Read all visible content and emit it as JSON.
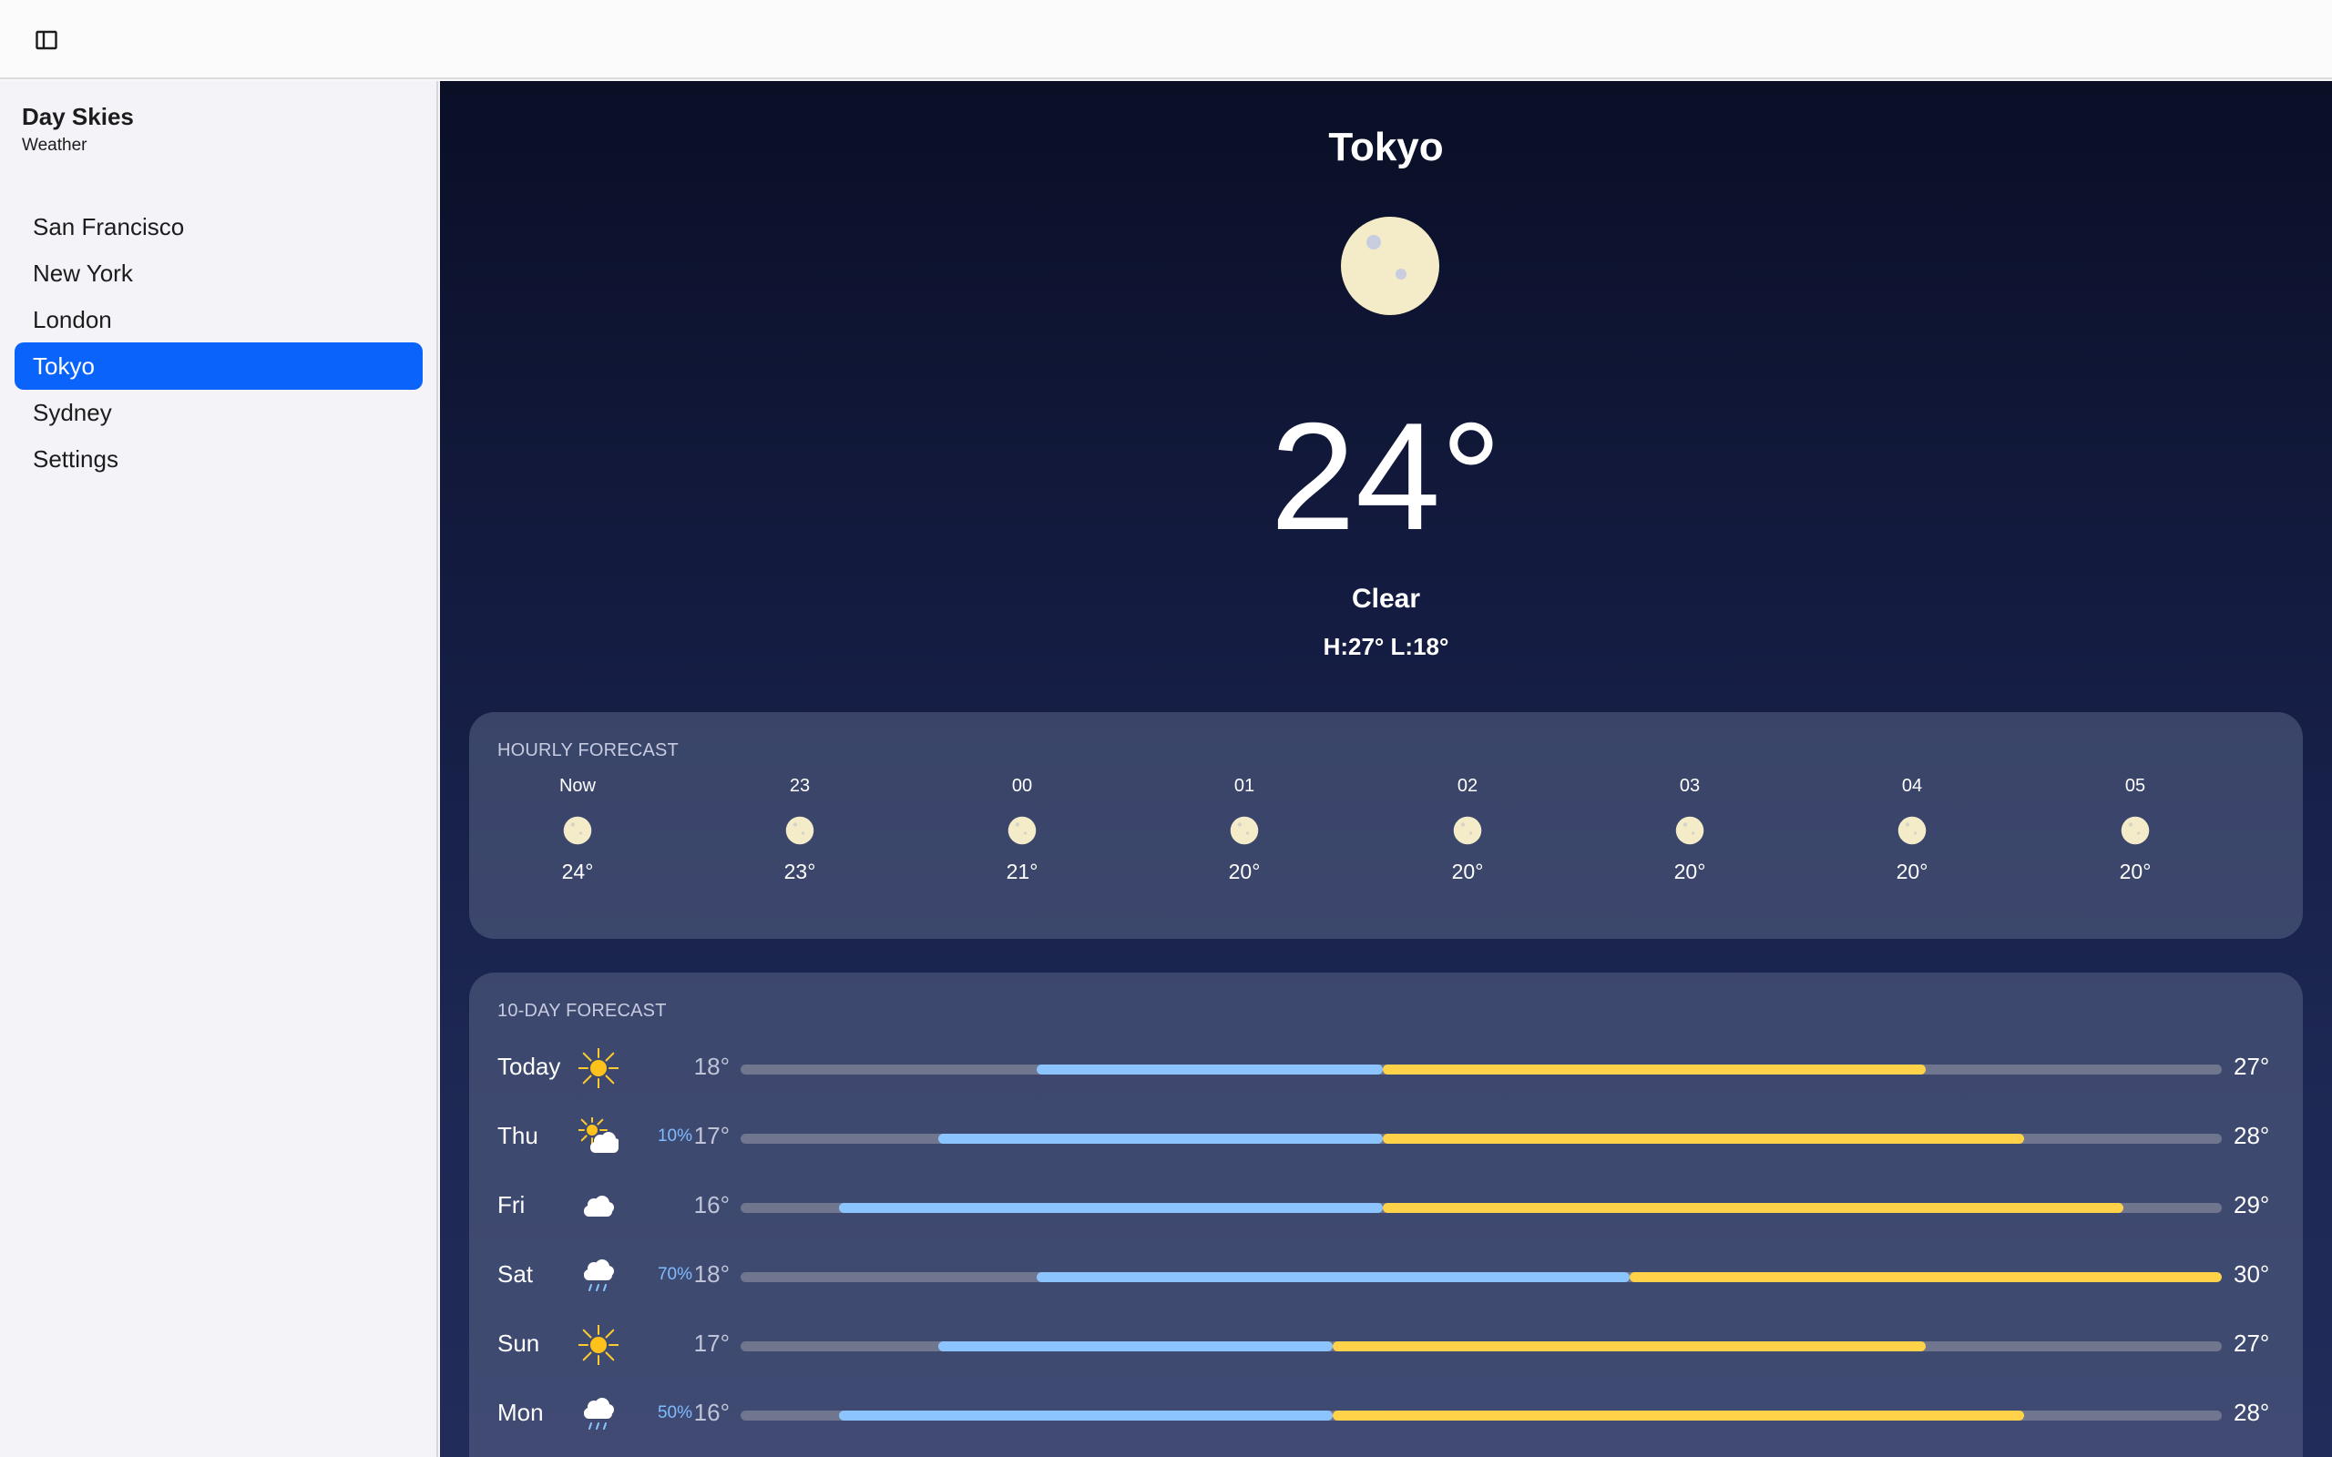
{
  "app": {
    "title": "Day Skies",
    "subtitle": "Weather"
  },
  "sidebar": {
    "items": [
      {
        "label": "San Francisco",
        "active": false
      },
      {
        "label": "New York",
        "active": false
      },
      {
        "label": "London",
        "active": false
      },
      {
        "label": "Tokyo",
        "active": true
      },
      {
        "label": "Sydney",
        "active": false
      },
      {
        "label": "Settings",
        "active": false
      }
    ]
  },
  "current": {
    "city": "Tokyo",
    "icon": "moon-icon",
    "temp": "24°",
    "condition": "Clear",
    "hilo": "H:27° L:18°"
  },
  "hourly": {
    "title": "HOURLY FORECAST",
    "items": [
      {
        "time": "Now",
        "icon": "moon-icon",
        "temp": "24°"
      },
      {
        "time": "23",
        "icon": "moon-icon",
        "temp": "23°"
      },
      {
        "time": "00",
        "icon": "moon-icon",
        "temp": "21°"
      },
      {
        "time": "01",
        "icon": "moon-icon",
        "temp": "20°"
      },
      {
        "time": "02",
        "icon": "moon-icon",
        "temp": "20°"
      },
      {
        "time": "03",
        "icon": "moon-icon",
        "temp": "20°"
      },
      {
        "time": "04",
        "icon": "moon-icon",
        "temp": "20°"
      },
      {
        "time": "05",
        "icon": "moon-icon",
        "temp": "20°"
      }
    ]
  },
  "daily": {
    "title": "10-DAY FORECAST",
    "range_min": 15,
    "range_max": 30,
    "items": [
      {
        "day": "Today",
        "icon": "sun-icon",
        "precip": "",
        "low": "18°",
        "high": "27°",
        "low_val": 18,
        "mid_val": 21.5,
        "high_val": 27
      },
      {
        "day": "Thu",
        "icon": "partly-cloudy-icon",
        "precip": "10%",
        "low": "17°",
        "high": "28°",
        "low_val": 17,
        "mid_val": 21.5,
        "high_val": 28
      },
      {
        "day": "Fri",
        "icon": "cloud-icon",
        "precip": "",
        "low": "16°",
        "high": "29°",
        "low_val": 16,
        "mid_val": 21.5,
        "high_val": 29
      },
      {
        "day": "Sat",
        "icon": "rain-icon",
        "precip": "70%",
        "low": "18°",
        "high": "30°",
        "low_val": 18,
        "mid_val": 24,
        "high_val": 30
      },
      {
        "day": "Sun",
        "icon": "sun-icon",
        "precip": "",
        "low": "17°",
        "high": "27°",
        "low_val": 17,
        "mid_val": 21,
        "high_val": 27
      },
      {
        "day": "Mon",
        "icon": "rain-icon",
        "precip": "50%",
        "low": "16°",
        "high": "28°",
        "low_val": 16,
        "mid_val": 21,
        "high_val": 28
      }
    ]
  },
  "colors": {
    "accent": "#0a64fb",
    "cool_bar": "#8cc4ff",
    "warm_bar": "#ffd24a",
    "precip": "#7fbcff"
  }
}
